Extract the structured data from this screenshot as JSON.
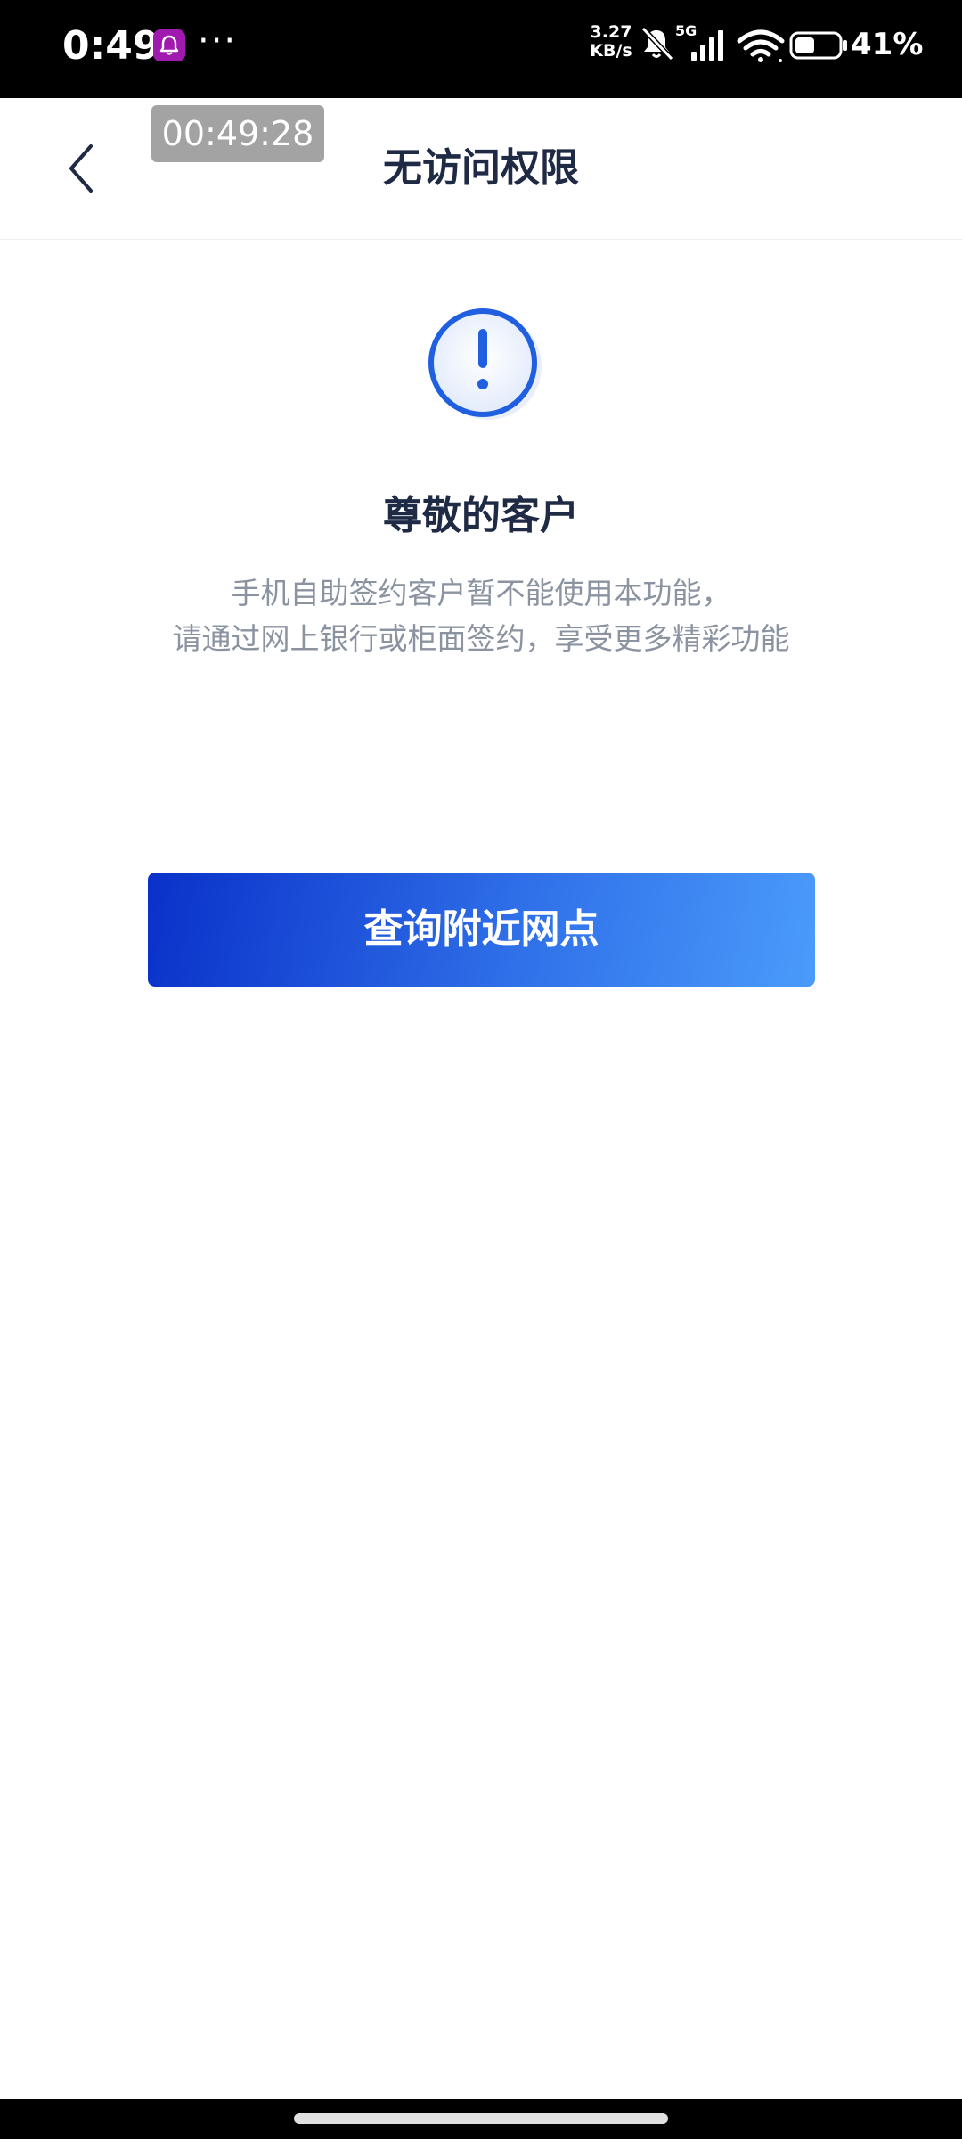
{
  "status_bar": {
    "time": "0:49",
    "more": "···",
    "net_speed_value": "3.27",
    "net_speed_unit": "KB/s",
    "network_type": "5G",
    "battery_percent": "41%",
    "icons": [
      "notification-app-icon",
      "bell-muted-icon",
      "signal-icon",
      "wifi-icon",
      "battery-icon"
    ]
  },
  "nav": {
    "title": "无访问权限",
    "timer": "00:49:28",
    "back_icon": "chevron-left-icon"
  },
  "content": {
    "icon": "exclamation-circle-icon",
    "heading": "尊敬的客户",
    "message_line1": "手机自助签约客户暂不能使用本功能，",
    "message_line2": "请通过网上银行或柜面签约，享受更多精彩功能",
    "button_label": "查询附近网点"
  },
  "colors": {
    "accent": "#1f5fe0",
    "button_gradient_start": "#0a31c9",
    "button_gradient_end": "#4a9bfb",
    "title_text": "#1f2a44",
    "secondary_text": "#8b93a1"
  }
}
